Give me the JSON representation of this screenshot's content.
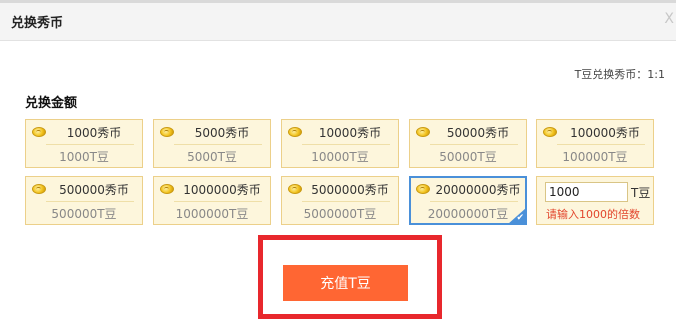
{
  "dialog": {
    "title": "兑换秀币",
    "close_label": "X"
  },
  "ratio_text": "T豆兑换秀币：1:1",
  "section_label": "兑换金额",
  "options": [
    {
      "xiubi": "1000秀币",
      "tdou": "1000T豆",
      "selected": false
    },
    {
      "xiubi": "5000秀币",
      "tdou": "5000T豆",
      "selected": false
    },
    {
      "xiubi": "10000秀币",
      "tdou": "10000T豆",
      "selected": false
    },
    {
      "xiubi": "50000秀币",
      "tdou": "50000T豆",
      "selected": false
    },
    {
      "xiubi": "100000秀币",
      "tdou": "100000T豆",
      "selected": false
    },
    {
      "xiubi": "500000秀币",
      "tdou": "500000T豆",
      "selected": false
    },
    {
      "xiubi": "1000000秀币",
      "tdou": "1000000T豆",
      "selected": false
    },
    {
      "xiubi": "5000000秀币",
      "tdou": "5000000T豆",
      "selected": false
    },
    {
      "xiubi": "20000000秀币",
      "tdou": "20000000T豆",
      "selected": true
    }
  ],
  "custom": {
    "value": "1000",
    "unit": "T豆",
    "hint": "请输入1000的倍数"
  },
  "recharge_button": "充值T豆",
  "colors": {
    "accent_button": "#ff6633",
    "highlight_border": "#e8282d",
    "selected_border": "#4a90d9",
    "tile_bg": "#fdf6dc",
    "hint_text": "#e2462d"
  },
  "icons": {
    "coin": "coin-icon",
    "check": "check-icon",
    "close": "close-icon"
  }
}
